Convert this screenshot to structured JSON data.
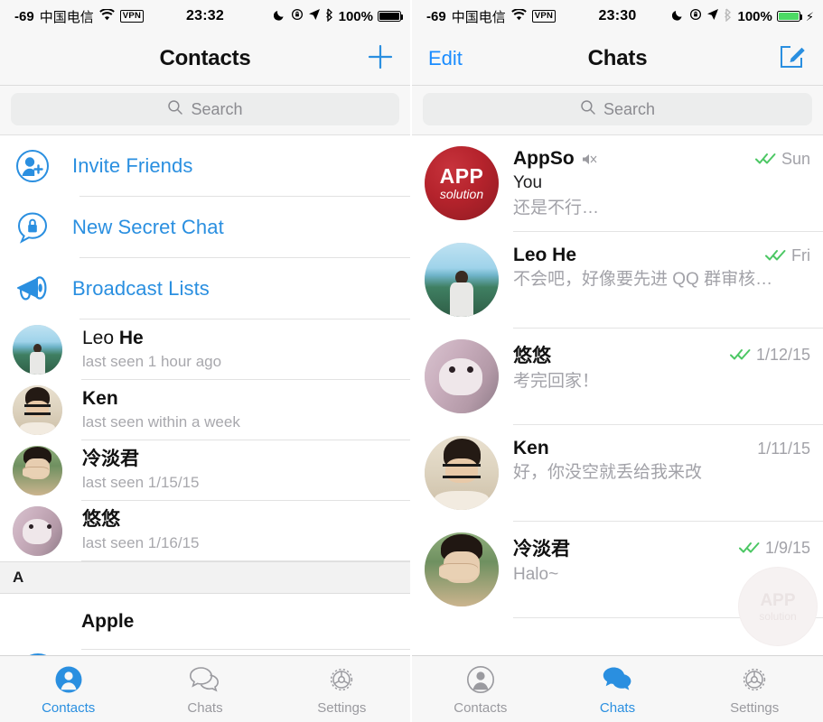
{
  "left": {
    "status": {
      "signal": "-69",
      "carrier": "中国电信",
      "wifi_icon": "wifi-icon",
      "vpn": "VPN",
      "time": "23:32",
      "moon_icon": "moon-icon",
      "lock_rotation_icon": "rotation-lock-icon",
      "location_icon": "location-arrow-icon",
      "bluetooth_icon": "bluetooth-icon",
      "battery_percent": "100%",
      "battery_state": "full"
    },
    "nav": {
      "title": "Contacts",
      "add_icon": "plus-icon"
    },
    "search": {
      "placeholder": "Search",
      "icon": "search-icon"
    },
    "actions": [
      {
        "label": "Invite Friends",
        "icon": "person-add-icon"
      },
      {
        "label": "New Secret Chat",
        "icon": "lock-bubble-icon"
      },
      {
        "label": "Broadcast Lists",
        "icon": "megaphone-icon"
      }
    ],
    "contacts": [
      {
        "first": "Leo ",
        "last": "He",
        "cjk": false,
        "sub": "last seen 1 hour ago",
        "avatar": "leo"
      },
      {
        "first": "",
        "last": "Ken",
        "cjk": false,
        "sub": "last seen within a week",
        "avatar": "ken"
      },
      {
        "first": "",
        "last": "冷淡君",
        "cjk": true,
        "sub": "last seen 1/15/15",
        "avatar": "leng"
      },
      {
        "first": "",
        "last": "悠悠",
        "cjk": true,
        "sub": "last seen 1/16/15",
        "avatar": "you"
      }
    ],
    "section_header": "A",
    "org": {
      "name": "Apple"
    },
    "tabs": [
      {
        "label": "Contacts",
        "icon": "contacts-icon",
        "active": true
      },
      {
        "label": "Chats",
        "icon": "chats-icon",
        "active": false
      },
      {
        "label": "Settings",
        "icon": "settings-gear-icon",
        "active": false
      }
    ]
  },
  "right": {
    "status": {
      "signal": "-69",
      "carrier": "中国电信",
      "wifi_icon": "wifi-icon",
      "vpn": "VPN",
      "time": "23:30",
      "moon_icon": "moon-icon",
      "lock_rotation_icon": "rotation-lock-icon",
      "location_icon": "location-arrow-icon",
      "bluetooth_icon": "bluetooth-icon",
      "battery_percent": "100%",
      "battery_state": "charging"
    },
    "nav": {
      "left_button": "Edit",
      "title": "Chats",
      "compose_icon": "compose-icon"
    },
    "search": {
      "placeholder": "Search",
      "icon": "search-icon"
    },
    "chats": [
      {
        "name": "AppSo",
        "muted": true,
        "mute_icon": "mute-speaker-icon",
        "sender": "You",
        "preview": "还是不行…",
        "ticks": true,
        "date": "Sun",
        "avatar": "appso"
      },
      {
        "name": "Leo He",
        "muted": false,
        "sender": "",
        "preview": "不会吧，好像要先进 QQ 群审核…",
        "ticks": true,
        "date": "Fri",
        "avatar": "leo"
      },
      {
        "name": "悠悠",
        "muted": false,
        "sender": "",
        "preview": "考完回家！",
        "ticks": true,
        "date": "1/12/15",
        "avatar": "you"
      },
      {
        "name": "Ken",
        "muted": false,
        "sender": "",
        "preview": "好，你没空就丢给我来改",
        "ticks": false,
        "date": "1/11/15",
        "avatar": "ken"
      },
      {
        "name": "冷淡君",
        "muted": false,
        "sender": "",
        "preview": "Halo~",
        "ticks": true,
        "date": "1/9/15",
        "avatar": "leng"
      }
    ],
    "watermark": {
      "line1": "APP",
      "line2": "solution"
    },
    "tabs": [
      {
        "label": "Contacts",
        "icon": "contacts-icon",
        "active": false
      },
      {
        "label": "Chats",
        "icon": "chats-icon",
        "active": true
      },
      {
        "label": "Settings",
        "icon": "settings-gear-icon",
        "active": false
      }
    ]
  },
  "colors": {
    "accent_blue": "#2a8fe0",
    "tick_green": "#4cc764",
    "muted_gray": "#a2a2a8",
    "bar_bg": "#f7f7f7",
    "appso_red": "#b5232c"
  }
}
